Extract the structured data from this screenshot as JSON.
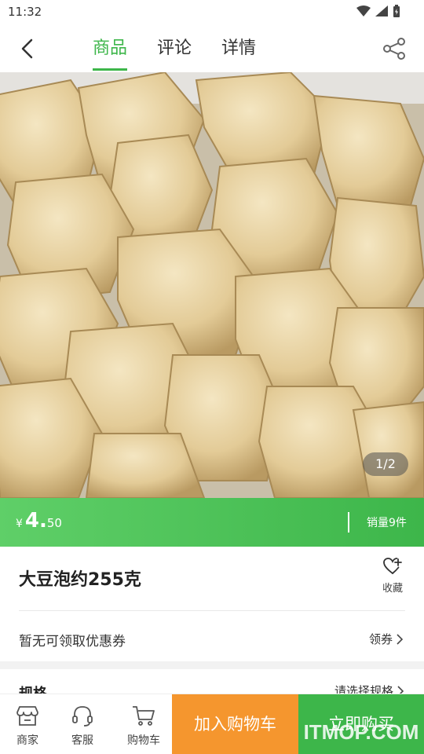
{
  "status_bar": {
    "time": "11:32"
  },
  "tabs": [
    {
      "label": "商品",
      "active": true
    },
    {
      "label": "评论",
      "active": false
    },
    {
      "label": "详情",
      "active": false
    }
  ],
  "image": {
    "counter": "1/2"
  },
  "price": {
    "currency": "¥",
    "integer": "4.",
    "decimal": "50",
    "sales": "销量9件"
  },
  "product": {
    "name": "大豆泡约255克",
    "favorite_label": "收藏"
  },
  "coupon": {
    "text": "暂无可领取优惠券",
    "link": "领券"
  },
  "spec": {
    "title": "规格",
    "link": "请选择规格"
  },
  "bottom_bar": {
    "shop": "商家",
    "service": "客服",
    "cart": "购物车",
    "add_to_cart": "加入购物车",
    "buy_now": "立即购买"
  },
  "watermark": "ITMOP.COM",
  "colors": {
    "accent": "#3db64a",
    "orange": "#f5962e"
  }
}
